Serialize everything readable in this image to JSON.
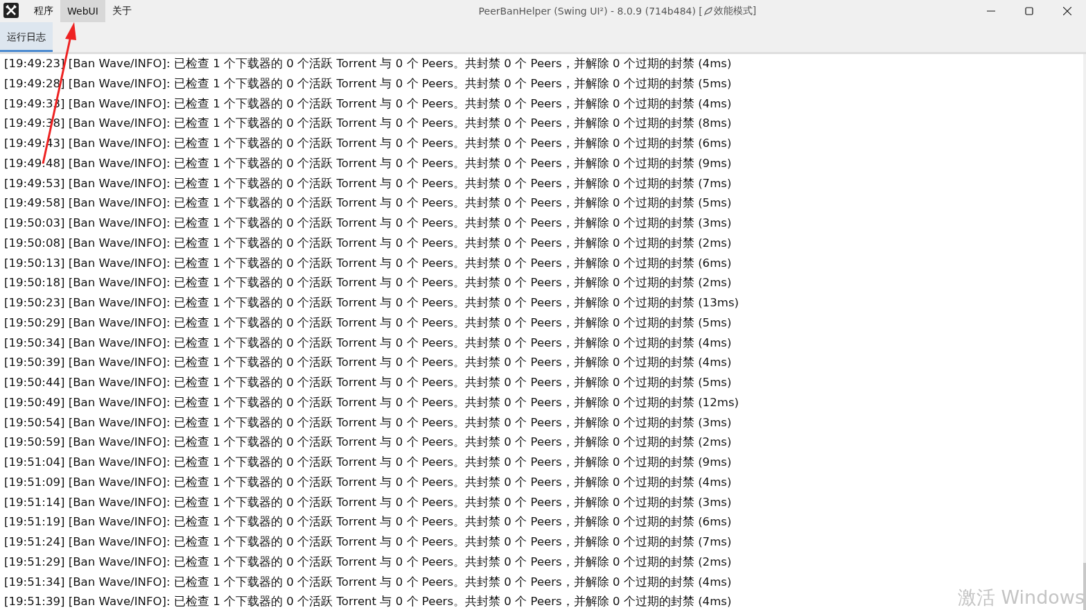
{
  "window": {
    "title": "PeerBanHelper (Swing UI²) - 8.0.9 (714b484) [",
    "title_suffix": "效能模式]"
  },
  "menu": [
    {
      "label": "程序",
      "selected": false
    },
    {
      "label": "WebUI",
      "selected": true
    },
    {
      "label": "关于",
      "selected": false
    }
  ],
  "tabs": [
    {
      "label": "运行日志",
      "selected": true
    }
  ],
  "log_lines": [
    "[19:49:23] [Ban Wave/INFO]: 已检查 1 个下载器的 0 个活跃 Torrent 与 0 个 Peers。共封禁 0 个 Peers，并解除 0 个过期的封禁 (4ms)",
    "[19:49:28] [Ban Wave/INFO]: 已检查 1 个下载器的 0 个活跃 Torrent 与 0 个 Peers。共封禁 0 个 Peers，并解除 0 个过期的封禁 (5ms)",
    "[19:49:33] [Ban Wave/INFO]: 已检查 1 个下载器的 0 个活跃 Torrent 与 0 个 Peers。共封禁 0 个 Peers，并解除 0 个过期的封禁 (4ms)",
    "[19:49:38] [Ban Wave/INFO]: 已检查 1 个下载器的 0 个活跃 Torrent 与 0 个 Peers。共封禁 0 个 Peers，并解除 0 个过期的封禁 (8ms)",
    "[19:49:43] [Ban Wave/INFO]: 已检查 1 个下载器的 0 个活跃 Torrent 与 0 个 Peers。共封禁 0 个 Peers，并解除 0 个过期的封禁 (6ms)",
    "[19:49:48] [Ban Wave/INFO]: 已检查 1 个下载器的 0 个活跃 Torrent 与 0 个 Peers。共封禁 0 个 Peers，并解除 0 个过期的封禁 (9ms)",
    "[19:49:53] [Ban Wave/INFO]: 已检查 1 个下载器的 0 个活跃 Torrent 与 0 个 Peers。共封禁 0 个 Peers，并解除 0 个过期的封禁 (7ms)",
    "[19:49:58] [Ban Wave/INFO]: 已检查 1 个下载器的 0 个活跃 Torrent 与 0 个 Peers。共封禁 0 个 Peers，并解除 0 个过期的封禁 (5ms)",
    "[19:50:03] [Ban Wave/INFO]: 已检查 1 个下载器的 0 个活跃 Torrent 与 0 个 Peers。共封禁 0 个 Peers，并解除 0 个过期的封禁 (3ms)",
    "[19:50:08] [Ban Wave/INFO]: 已检查 1 个下载器的 0 个活跃 Torrent 与 0 个 Peers。共封禁 0 个 Peers，并解除 0 个过期的封禁 (2ms)",
    "[19:50:13] [Ban Wave/INFO]: 已检查 1 个下载器的 0 个活跃 Torrent 与 0 个 Peers。共封禁 0 个 Peers，并解除 0 个过期的封禁 (6ms)",
    "[19:50:18] [Ban Wave/INFO]: 已检查 1 个下载器的 0 个活跃 Torrent 与 0 个 Peers。共封禁 0 个 Peers，并解除 0 个过期的封禁 (2ms)",
    "[19:50:23] [Ban Wave/INFO]: 已检查 1 个下载器的 0 个活跃 Torrent 与 0 个 Peers。共封禁 0 个 Peers，并解除 0 个过期的封禁 (13ms)",
    "[19:50:29] [Ban Wave/INFO]: 已检查 1 个下载器的 0 个活跃 Torrent 与 0 个 Peers。共封禁 0 个 Peers，并解除 0 个过期的封禁 (5ms)",
    "[19:50:34] [Ban Wave/INFO]: 已检查 1 个下载器的 0 个活跃 Torrent 与 0 个 Peers。共封禁 0 个 Peers，并解除 0 个过期的封禁 (4ms)",
    "[19:50:39] [Ban Wave/INFO]: 已检查 1 个下载器的 0 个活跃 Torrent 与 0 个 Peers。共封禁 0 个 Peers，并解除 0 个过期的封禁 (4ms)",
    "[19:50:44] [Ban Wave/INFO]: 已检查 1 个下载器的 0 个活跃 Torrent 与 0 个 Peers。共封禁 0 个 Peers，并解除 0 个过期的封禁 (5ms)",
    "[19:50:49] [Ban Wave/INFO]: 已检查 1 个下载器的 0 个活跃 Torrent 与 0 个 Peers。共封禁 0 个 Peers，并解除 0 个过期的封禁 (12ms)",
    "[19:50:54] [Ban Wave/INFO]: 已检查 1 个下载器的 0 个活跃 Torrent 与 0 个 Peers。共封禁 0 个 Peers，并解除 0 个过期的封禁 (3ms)",
    "[19:50:59] [Ban Wave/INFO]: 已检查 1 个下载器的 0 个活跃 Torrent 与 0 个 Peers。共封禁 0 个 Peers，并解除 0 个过期的封禁 (2ms)",
    "[19:51:04] [Ban Wave/INFO]: 已检查 1 个下载器的 0 个活跃 Torrent 与 0 个 Peers。共封禁 0 个 Peers，并解除 0 个过期的封禁 (9ms)",
    "[19:51:09] [Ban Wave/INFO]: 已检查 1 个下载器的 0 个活跃 Torrent 与 0 个 Peers。共封禁 0 个 Peers，并解除 0 个过期的封禁 (4ms)",
    "[19:51:14] [Ban Wave/INFO]: 已检查 1 个下载器的 0 个活跃 Torrent 与 0 个 Peers。共封禁 0 个 Peers，并解除 0 个过期的封禁 (3ms)",
    "[19:51:19] [Ban Wave/INFO]: 已检查 1 个下载器的 0 个活跃 Torrent 与 0 个 Peers。共封禁 0 个 Peers，并解除 0 个过期的封禁 (6ms)",
    "[19:51:24] [Ban Wave/INFO]: 已检查 1 个下载器的 0 个活跃 Torrent 与 0 个 Peers。共封禁 0 个 Peers，并解除 0 个过期的封禁 (7ms)",
    "[19:51:29] [Ban Wave/INFO]: 已检查 1 个下载器的 0 个活跃 Torrent 与 0 个 Peers。共封禁 0 个 Peers，并解除 0 个过期的封禁 (2ms)",
    "[19:51:34] [Ban Wave/INFO]: 已检查 1 个下载器的 0 个活跃 Torrent 与 0 个 Peers。共封禁 0 个 Peers，并解除 0 个过期的封禁 (4ms)",
    "[19:51:39] [Ban Wave/INFO]: 已检查 1 个下载器的 0 个活跃 Torrent 与 0 个 Peers。共封禁 0 个 Peers，并解除 0 个过期的封禁 (4ms)"
  ],
  "os_notice": "激活 Windows"
}
